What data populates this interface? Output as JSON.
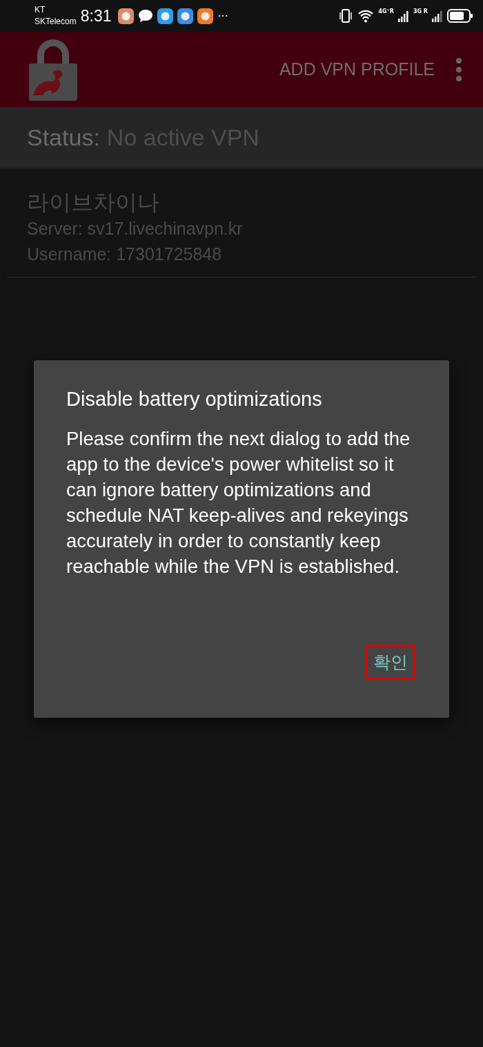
{
  "status_bar": {
    "carrier_top": "KT",
    "carrier_bottom": "SKTelecom",
    "time": "8:31",
    "more": "···",
    "network_1": "4G⁺R",
    "network_2": "3G R"
  },
  "toolbar": {
    "action": "ADD VPN PROFILE"
  },
  "status": {
    "label": "Status:",
    "value": "No active VPN"
  },
  "profiles": [
    {
      "name": "라이브차이나",
      "server": "Server: sv17.livechinavpn.kr",
      "username": "Username: 17301725848"
    }
  ],
  "dialog": {
    "title": "Disable battery optimizations",
    "message": "Please confirm the next dialog to add the app to the device's power whitelist so it can ignore battery optimizations and schedule NAT keep-alives and rekeyings accurately in order to constantly keep reachable while the VPN is established.",
    "button": {
      "label": "확인",
      "highlighted": true
    }
  }
}
